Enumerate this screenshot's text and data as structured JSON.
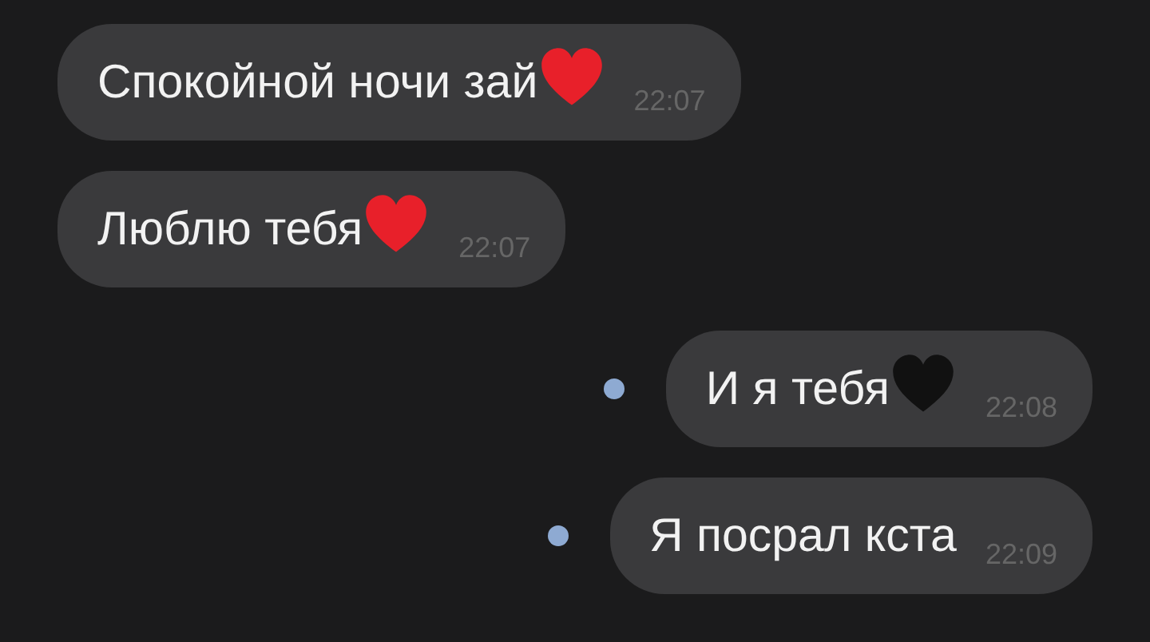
{
  "messages": [
    {
      "text": "Спокойной ночи зай",
      "time": "22:07",
      "outgoing": false,
      "color": "#e8202a"
    },
    {
      "text": "Люблю тебя",
      "time": "22:07",
      "outgoing": false,
      "color": "#e8202a"
    },
    {
      "text": "И я тебя",
      "time": "22:08",
      "outgoing": true,
      "unread": true,
      "color": "#111111"
    },
    {
      "text": "Я посрал кста",
      "time": "22:09",
      "outgoing": true,
      "unread": true
    }
  ]
}
